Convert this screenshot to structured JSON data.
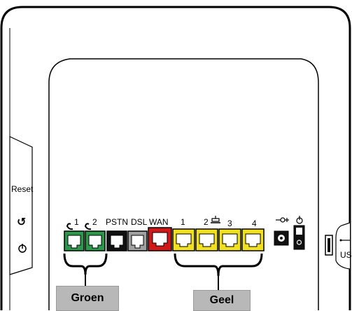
{
  "device": {
    "side_panel": {
      "reset_label": "Reset",
      "wps_icon": "wps-icon",
      "power_icon": "power-icon"
    },
    "rear_panel": {
      "phone_port_1_label": "1",
      "phone_port_2_label": "2",
      "pstn_label": "PSTN",
      "dsl_label": "DSL",
      "wan_label": "WAN",
      "lan_1_label": "1",
      "lan_2_label": "2",
      "lan_3_label": "3",
      "lan_4_label": "4",
      "usb_label": "USB"
    },
    "callouts": {
      "green_label": "Groen",
      "yellow_label": "Geel"
    },
    "colors": {
      "green_port": "#2a9a4a",
      "pstn_port": "#111111",
      "dsl_port": "#a0a0a0",
      "wan_port": "#d01818",
      "lan_port": "#f0e020",
      "callout_bg": "#b8b8b8"
    }
  }
}
